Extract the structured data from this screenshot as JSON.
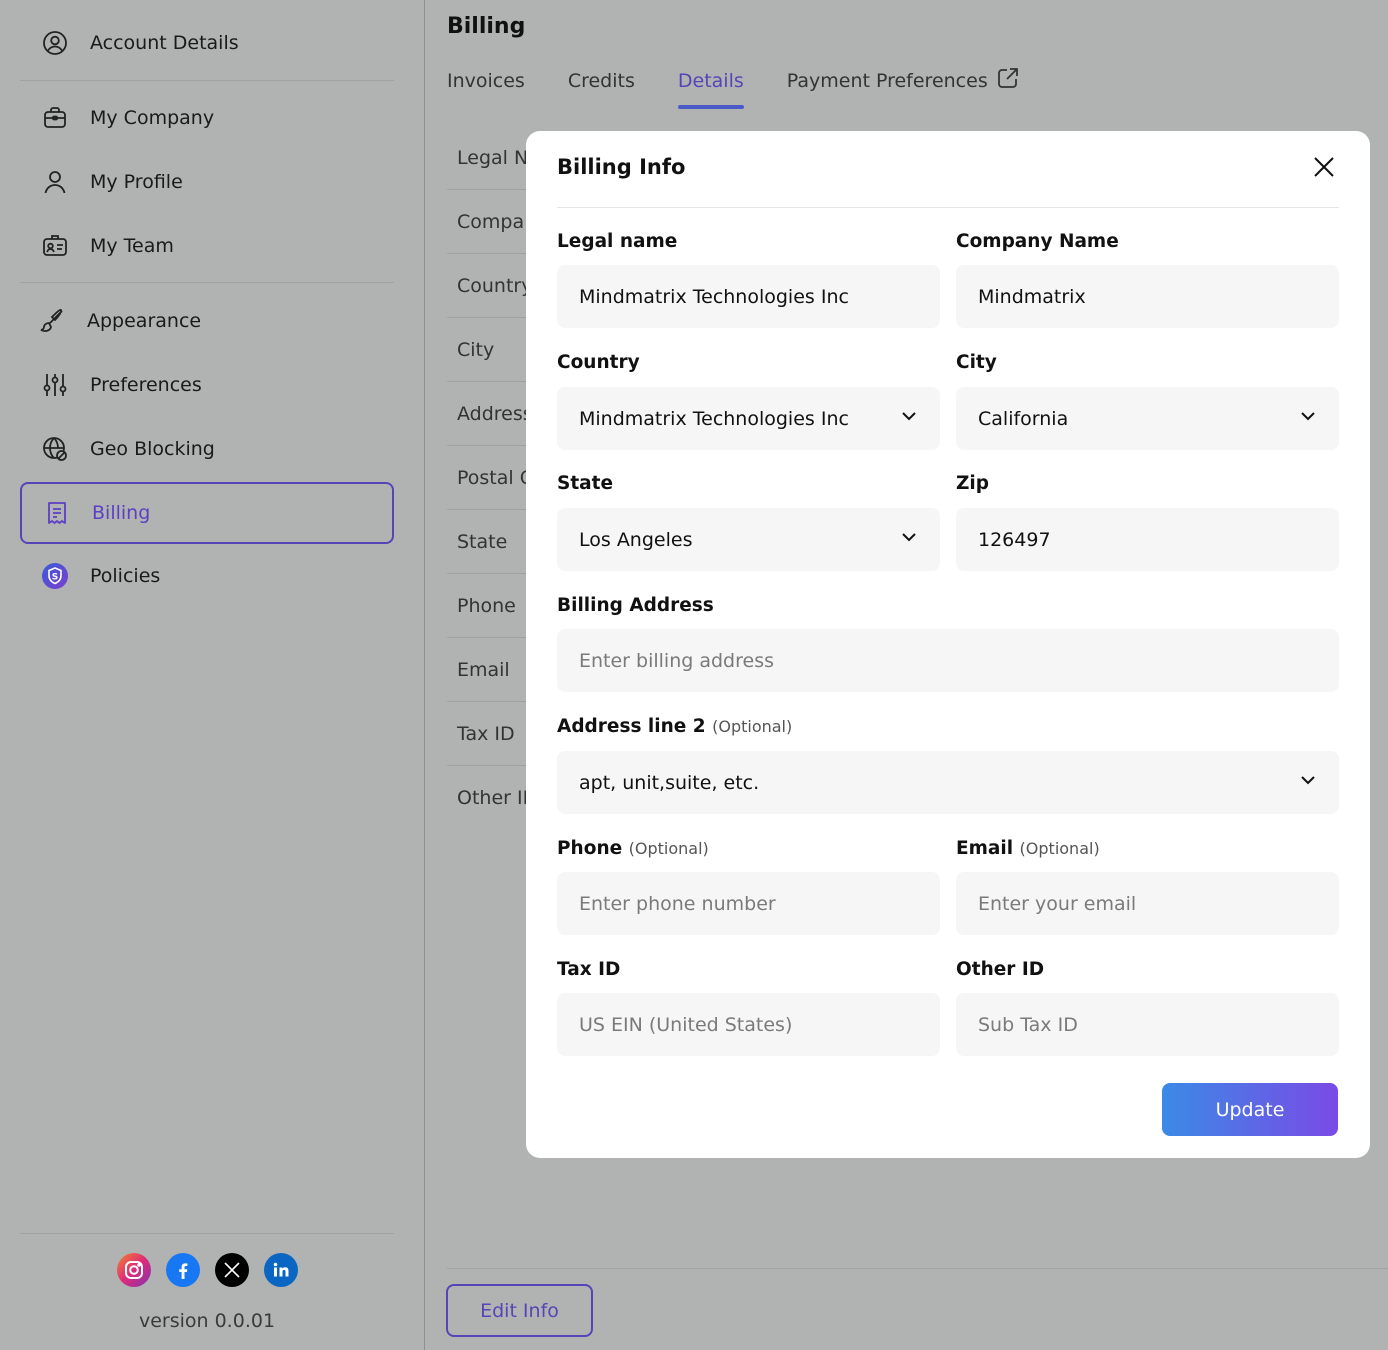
{
  "sidebar": {
    "items": [
      {
        "label": "Account Details",
        "icon": "user-circle-icon"
      },
      {
        "label": "My Company",
        "icon": "briefcase-icon"
      },
      {
        "label": "My Profile",
        "icon": "user-icon"
      },
      {
        "label": "My Team",
        "icon": "id-card-icon"
      },
      {
        "label": "Appearance",
        "icon": "paint-brush-icon"
      },
      {
        "label": "Preferences",
        "icon": "sliders-icon"
      },
      {
        "label": "Geo Blocking",
        "icon": "globe-block-icon"
      },
      {
        "label": "Billing",
        "icon": "receipt-icon"
      },
      {
        "label": "Policies",
        "icon": "shield-icon"
      }
    ],
    "active": "Billing",
    "socials": [
      "instagram-icon",
      "facebook-icon",
      "x-icon",
      "linkedin-icon"
    ],
    "version": "version 0.0.01"
  },
  "main": {
    "title": "Billing",
    "tabs": [
      "Invoices",
      "Credits",
      "Details",
      "Payment Preferences"
    ],
    "active_tab": "Details",
    "background_rows": [
      "Legal Na",
      "Compa",
      "Country",
      "City",
      "Address",
      "Postal C",
      "State",
      "Phone",
      "Email",
      "Tax ID",
      "Other ID"
    ],
    "edit_button": "Edit Info"
  },
  "modal": {
    "title": "Billing Info",
    "fields": {
      "legal_name": {
        "label": "Legal name",
        "value": "Mindmatrix Technologies Inc"
      },
      "company_name": {
        "label": "Company Name",
        "value": "Mindmatrix"
      },
      "country": {
        "label": "Country",
        "value": "Mindmatrix Technologies Inc"
      },
      "city": {
        "label": "City",
        "value": "California"
      },
      "state": {
        "label": "State",
        "value": "Los Angeles"
      },
      "zip": {
        "label": "Zip",
        "value": "126497"
      },
      "billing_address": {
        "label": "Billing Address",
        "placeholder": "Enter billing address"
      },
      "address_line2": {
        "label": "Address line 2",
        "optional": "(Optional)",
        "value": "apt, unit,suite, etc."
      },
      "phone": {
        "label": "Phone",
        "optional": "(Optional)",
        "placeholder": "Enter phone number"
      },
      "email": {
        "label": "Email",
        "optional": "(Optional)",
        "placeholder": "Enter your email"
      },
      "tax_id": {
        "label": "Tax ID",
        "placeholder": "US EIN (United States)"
      },
      "other_id": {
        "label": "Other ID",
        "placeholder": "Sub Tax ID"
      }
    },
    "update_button": "Update"
  },
  "colors": {
    "accent": "#5744b7",
    "overlay_bg": "#b1b3b3",
    "button_gradient_start": "#3b8ae6",
    "button_gradient_end": "#7a4ae6"
  }
}
